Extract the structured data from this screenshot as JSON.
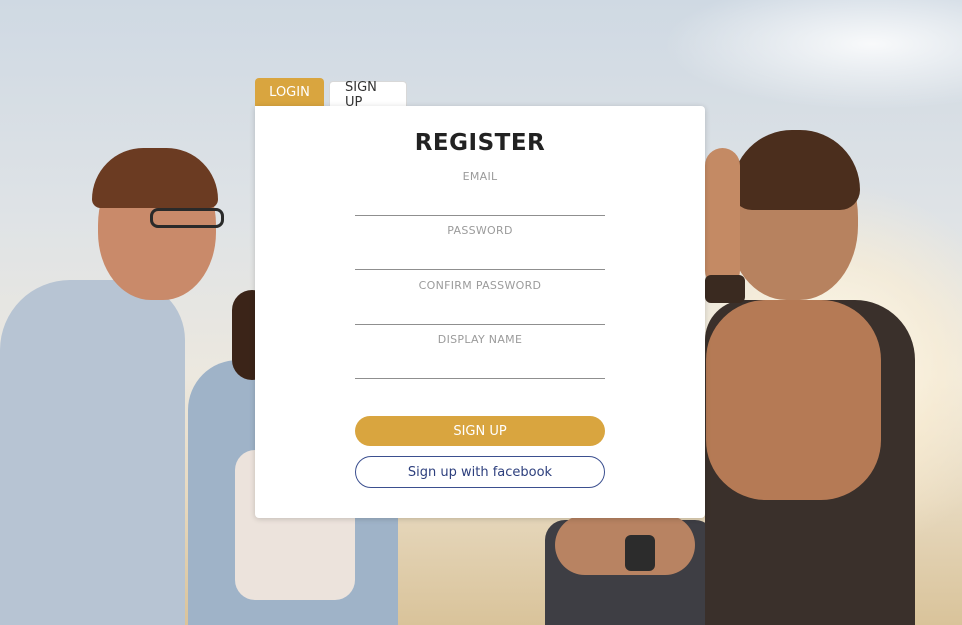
{
  "tabs": {
    "login_label": "LOGIN",
    "signup_label": "SIGN UP"
  },
  "form": {
    "title": "REGISTER",
    "fields": {
      "email_label": "EMAIL",
      "password_label": "PASSWORD",
      "confirm_label": "CONFIRM PASSWORD",
      "display_label": "DISPLAY NAME"
    },
    "signup_button": "SIGN UP",
    "facebook_button": "Sign up with facebook"
  },
  "colors": {
    "accent": "#d9a53f",
    "facebook_border": "#3b4f8f",
    "card_bg": "#ffffff"
  }
}
